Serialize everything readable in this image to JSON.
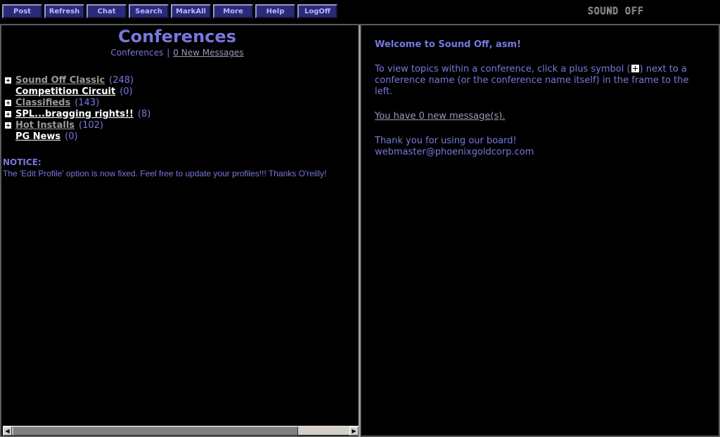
{
  "toolbar": {
    "buttons": [
      "Post",
      "Refresh",
      "Chat",
      "Search",
      "MarkAll",
      "More",
      "Help",
      "LogOff"
    ],
    "logo": "SOUND OFF"
  },
  "left": {
    "title": "Conferences",
    "subnav": {
      "current": "Conferences",
      "separator": "|",
      "new_messages": "0 New Messages"
    },
    "conferences": [
      {
        "name": "Sound Off Classic",
        "count": "(248)",
        "expandable": true
      },
      {
        "name": "Competition Circuit",
        "count": "(0)",
        "expandable": false
      },
      {
        "name": "Classifieds",
        "count": "(143)",
        "expandable": true
      },
      {
        "name": "SPL...bragging rights!!",
        "count": "(8)",
        "expandable": true
      },
      {
        "name": "Hot Installs",
        "count": "(102)",
        "expandable": true
      },
      {
        "name": "PG News",
        "count": "(0)",
        "expandable": false
      }
    ],
    "notice_label": "NOTICE:",
    "notice_text": "The 'Edit Profile' option is now fixed. Feel free to update your profiles!!! Thanks O'reilly!"
  },
  "right": {
    "welcome": "Welcome to Sound Off, asm!",
    "instructions_before": "To view topics within a conference, click a plus symbol (",
    "instructions_after": ") next to a conference name (or the conference name itself) in the frame to the left.",
    "new_messages": "You have 0 new message(s).",
    "thanks": "Thank you for using our board!",
    "email": "webmaster@phoenixgoldcorp.com"
  },
  "colors": {
    "background": "#000000",
    "text": "#7878e0",
    "button_face": "#2a2a78",
    "link_grey": "#9a9a9a",
    "link_white": "#ffffff"
  }
}
